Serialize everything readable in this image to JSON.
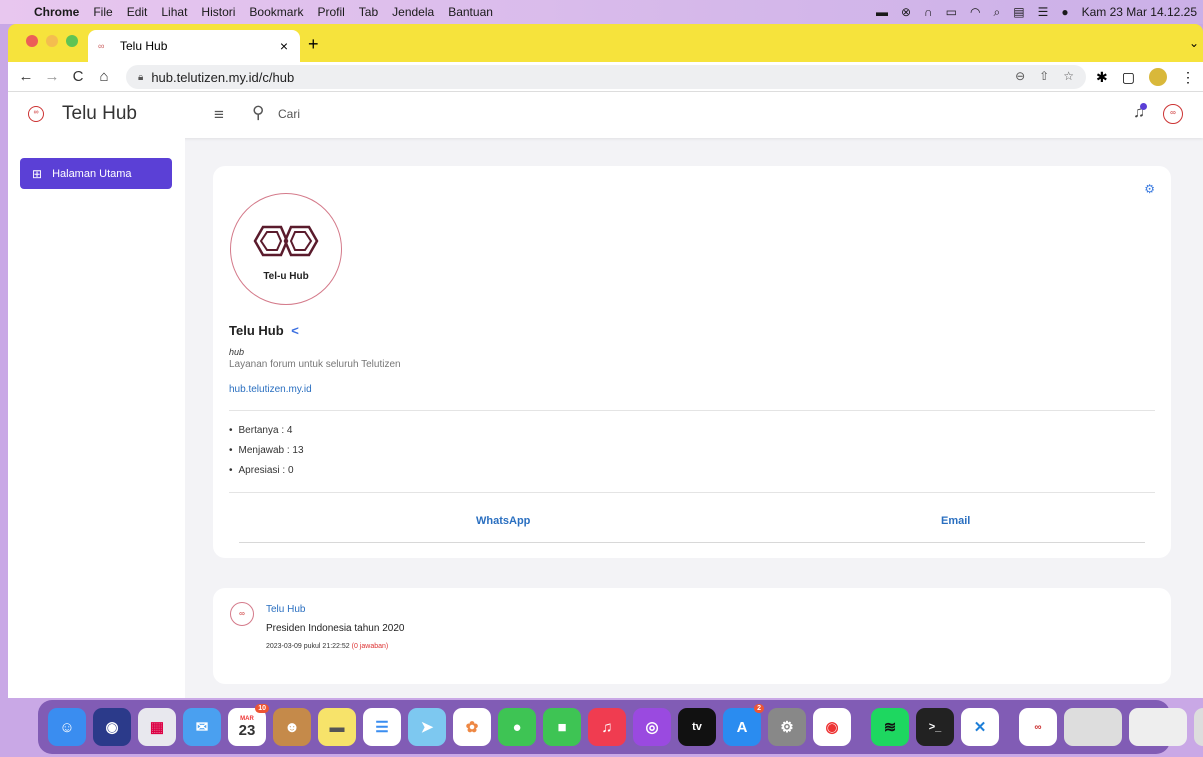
{
  "menubar": {
    "app": "Chrome",
    "items": [
      "File",
      "Edit",
      "Lihat",
      "Histori",
      "Bookmark",
      "Profil",
      "Tab",
      "Jendela",
      "Bantuan"
    ],
    "clock": "Kam 23 Mar 14.12.25"
  },
  "browser": {
    "tab_title": "Telu Hub",
    "url": "hub.telutizen.my.id/c/hub"
  },
  "header": {
    "brand": "Telu Hub",
    "search_placeholder": "Cari"
  },
  "sidebar": {
    "items": [
      {
        "label": "Halaman Utama",
        "active": true
      }
    ]
  },
  "hub": {
    "logo_label": "Tel-u Hub",
    "name": "Telu Hub",
    "type": "hub",
    "description": "Layanan forum untuk seluruh Telutizen",
    "link": "hub.telutizen.my.id",
    "stats": [
      {
        "text": "Bertanya : 4"
      },
      {
        "text": "Menjawab : 13"
      },
      {
        "text": "Apresiasi : 0"
      }
    ],
    "actions": {
      "whatsapp": "WhatsApp",
      "email": "Email"
    }
  },
  "post": {
    "author": "Telu Hub",
    "text": "Presiden Indonesia tahun 2020",
    "meta": "2023-03-09 pukul 21:22:52",
    "answers": "(0 jawaban)"
  },
  "dock": {
    "calendar_month": "MAR",
    "calendar_day": "23",
    "calendar_badge": "10",
    "appstore_badge": "2",
    "tv_label": "tv"
  },
  "colors": {
    "accent": "#5b40d6",
    "link": "#2a6fc0",
    "tabstrip": "#f6e33c",
    "logo_red": "#c0334e"
  }
}
